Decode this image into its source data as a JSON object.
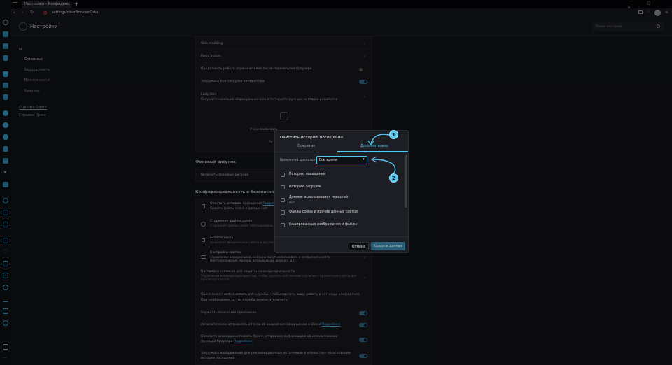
{
  "tabs": [
    {
      "label": "Настройки – Конфиденц"
    }
  ],
  "address": "settings/clearBrowserData",
  "header": {
    "title": "Настройки",
    "search_placeholder": "Поиск настроек"
  },
  "leftnav": {
    "group": "Ы",
    "items": [
      "Основные",
      "Безопасность",
      "Возможности",
      "Браузер"
    ],
    "links": [
      "Оценить Opera",
      "Справка Opera"
    ]
  },
  "content": {
    "rows_top": [
      {
        "label": "Web modding"
      },
      {
        "label": "Panic button"
      },
      {
        "label": "Продолжать работу ограничителей после перезапуска браузера"
      },
      {
        "label": "Загружать при загрузке компьютера"
      }
    ],
    "early_bird": {
      "title": "Early Bird",
      "sub": "Получайте новейшие сборки раньше всех и тестируйте функции на стадии разработки."
    },
    "partial_texts": [
      "У нас появилась",
      "Ро"
    ],
    "bg_section": "Фоновый рисунок",
    "bg_row": "Включить фоновые рисунки",
    "privacy_section": "Конфиденциальность и безопасность",
    "privacy_rows": [
      {
        "label": "Очистить историю посещений",
        "link": "Подробнее",
        "sub": "Удалить файлы cookie и данные сайт"
      },
      {
        "label": "Сторонние файлы cookie",
        "sub": "Сторонние файлы cookie заблокированы"
      },
      {
        "label": "Безопасность",
        "sub": "Защита от вредоносных сайтов и других"
      },
      {
        "label": "Настройки сайтов",
        "sub": "Управление информацией, которую могут использовать и отображать сайты (местоположение, камера, всплывающие окна и т. д.)"
      },
      {
        "label": "Настройки согласия для защиты конфиденциальности",
        "sub": "Управление конфиденциальностью, чтобы сделать собственное согласие с просмотром сайтов для просмотра сайтов"
      }
    ],
    "info_text": "Opera может использовать веб-службы, чтобы сделать вашу работу в сети еще комфортнее. При необходимости эти службы можно отключить.",
    "toggle_rows": [
      {
        "label": "Улучшать подсказки при поиске",
        "link": ""
      },
      {
        "label": "Автоматически отправлять отчеты об аварийном завершении в Opera",
        "link": "Подробнее"
      },
      {
        "label": "Помогите усовершенствовать Opera, отправляя информацию об использовании функций браузера",
        "link": "Подробнее"
      },
      {
        "label": "Загружать изображения для рекомендованных источников в «Новостях» на основании истории посещений",
        "link": ""
      }
    ]
  },
  "dialog": {
    "title": "Очистить историю посещений",
    "tabs": [
      "Основные",
      "Дополнительно"
    ],
    "time_label": "Временной диапазон",
    "time_value": "Все время",
    "items": [
      {
        "label": "Историю посещений",
        "sub": ""
      },
      {
        "label": "Историю загрузок",
        "sub": ""
      },
      {
        "label": "Данные использования новостей",
        "sub": "Нет"
      },
      {
        "label": "Файлы cookie и прочие данные сайтов",
        "sub": ""
      },
      {
        "label": "Кэшированные изображения и файлы",
        "sub": ""
      }
    ],
    "cancel": "Отмена",
    "delete": "Удалить данные"
  },
  "callouts": [
    "1",
    "2"
  ],
  "colors": {
    "accent": "#58c6ec",
    "toggle_on": "#2d6a86",
    "background": "#121317"
  }
}
